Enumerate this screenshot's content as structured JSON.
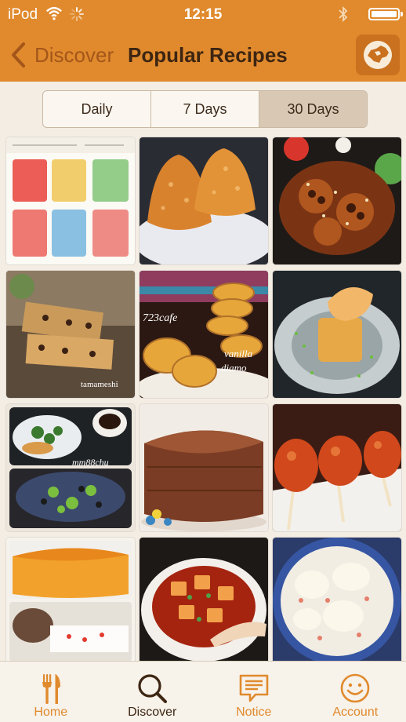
{
  "status_bar": {
    "carrier": "iPod",
    "time": "12:15"
  },
  "nav": {
    "back_label": "Discover",
    "title": "Popular Recipes",
    "map_icon": "map-icon"
  },
  "segments": [
    {
      "label": "Daily",
      "active": false
    },
    {
      "label": "7 Days",
      "active": false
    },
    {
      "label": "30 Days",
      "active": true
    }
  ],
  "recipe_images": [
    {
      "description": "illustrated recipe card"
    },
    {
      "description": "rice balls"
    },
    {
      "description": "glazed lotus root with sesame"
    },
    {
      "description": "chocolate chip bars",
      "watermark": "tamameshi"
    },
    {
      "description": "vanilla diamond cookies",
      "watermark": "723cafe"
    },
    {
      "description": "plated fish dish"
    },
    {
      "description": "vegetable side dishes",
      "watermark": "mm88chu"
    },
    {
      "description": "chocolate cake"
    },
    {
      "description": "meatball skewers"
    },
    {
      "description": "sponge cake"
    },
    {
      "description": "mapo tofu"
    },
    {
      "description": "creamy stew"
    }
  ],
  "tabs": [
    {
      "label": "Home",
      "icon": "fork-knife-icon",
      "active": false
    },
    {
      "label": "Discover",
      "icon": "search-icon",
      "active": true
    },
    {
      "label": "Notice",
      "icon": "message-icon",
      "active": false
    },
    {
      "label": "Account",
      "icon": "smiley-icon",
      "active": false
    }
  ],
  "colors": {
    "accent": "#e08a2d",
    "background": "#f3ede4",
    "title": "#3d2512"
  }
}
